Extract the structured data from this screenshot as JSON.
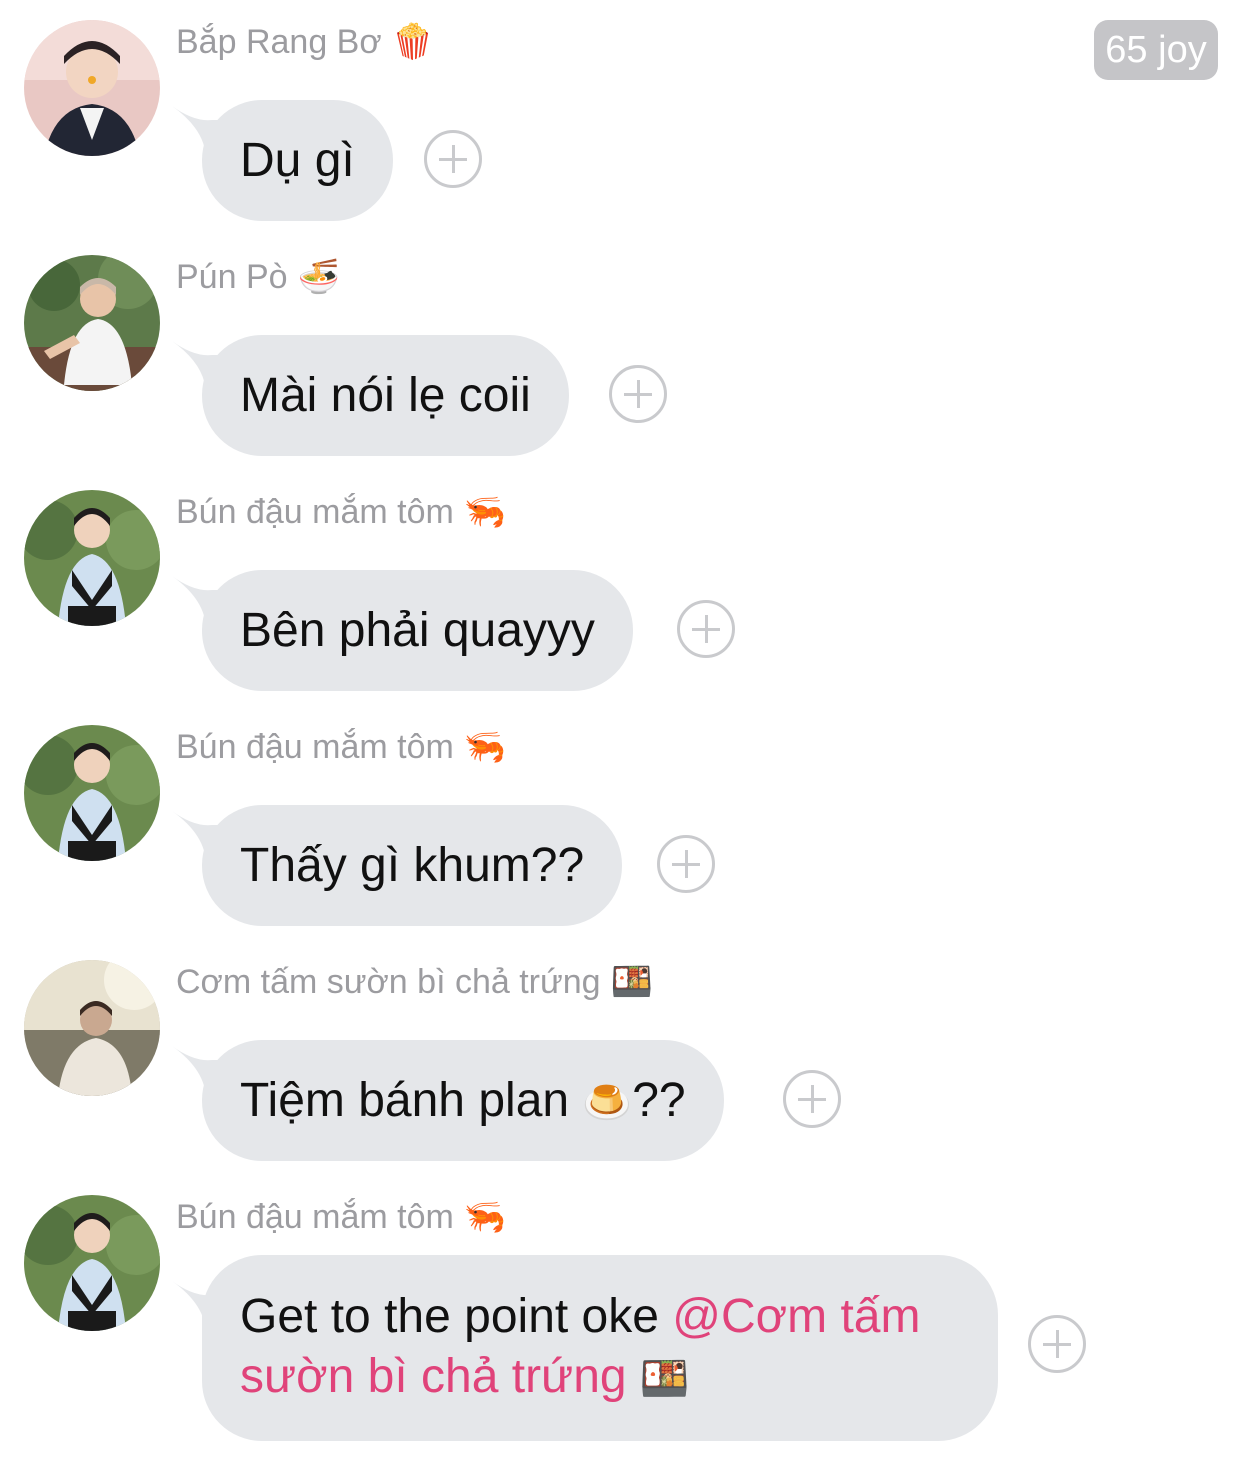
{
  "header": {
    "badge": "65 joy"
  },
  "messages": [
    {
      "sender": "Bắp Rang Bơ",
      "sender_emoji": "🍿",
      "avatar_icon": "person-avatar",
      "text": "Dụ gì"
    },
    {
      "sender": "Pún Pò",
      "sender_emoji": "🍜",
      "avatar_icon": "person-avatar",
      "text": "Mài nói lẹ coii"
    },
    {
      "sender": "Bún đậu mắm tôm",
      "sender_emoji": "🦐",
      "avatar_icon": "person-avatar",
      "text": "Bên phải quayyy"
    },
    {
      "sender": "Bún đậu mắm tôm",
      "sender_emoji": "🦐",
      "avatar_icon": "person-avatar",
      "text": "Thấy gì khum??"
    },
    {
      "sender": "Cơm tấm sườn bì chả trứng",
      "sender_emoji": "🍱",
      "avatar_icon": "person-avatar",
      "text_before": "Tiệm bánh plan ",
      "text_emoji": "🍮",
      "text_after": "??"
    },
    {
      "sender": "Bún đậu mắm tôm",
      "sender_emoji": "🦐",
      "avatar_icon": "person-avatar",
      "text": "Get to the point oke ",
      "mention": "@Cơm tấm sườn bì chả trứng",
      "mention_emoji": "🍱"
    }
  ],
  "colors": {
    "bubble": "#e5e7ea",
    "sender": "#9c9ca0",
    "mention": "#e0437a",
    "badge": "#c5c5c8"
  }
}
